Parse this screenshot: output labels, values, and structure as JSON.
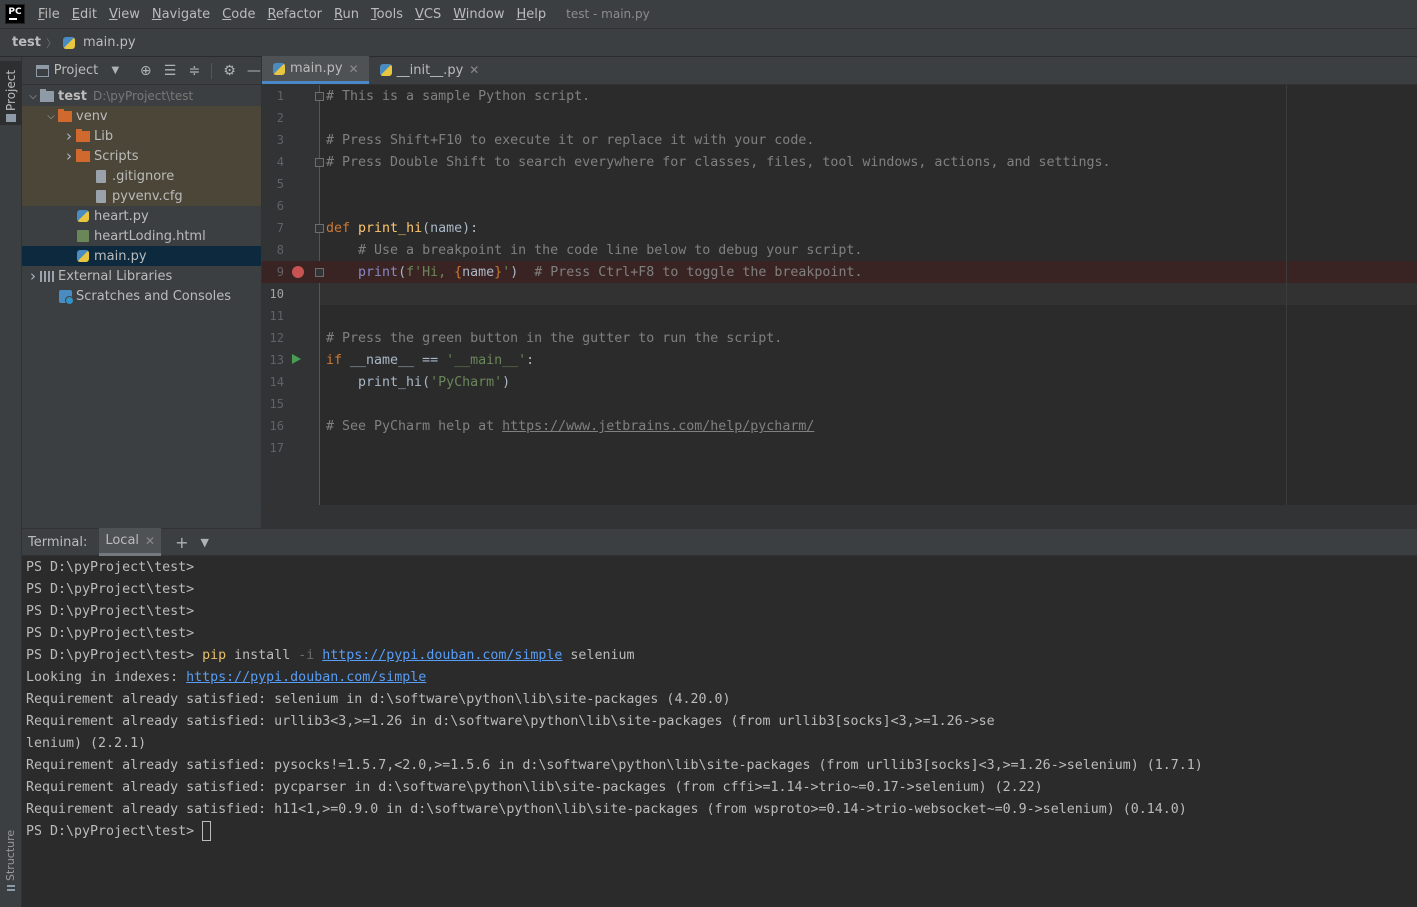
{
  "menubar": {
    "logo": "PC",
    "items": [
      {
        "u": "F",
        "rest": "ile"
      },
      {
        "u": "E",
        "rest": "dit"
      },
      {
        "u": "V",
        "rest": "iew"
      },
      {
        "u": "N",
        "rest": "avigate"
      },
      {
        "u": "C",
        "rest": "ode"
      },
      {
        "u": "R",
        "rest": "efactor"
      },
      {
        "u": "R",
        "rest": "un"
      },
      {
        "u": "T",
        "rest": "ools"
      },
      {
        "u": "V",
        "rest": "CS"
      },
      {
        "u": "W",
        "rest": "indow"
      },
      {
        "u": "H",
        "rest": "elp"
      }
    ],
    "window_title": "test - main.py"
  },
  "breadcrumb": {
    "root": "test",
    "file": "main.py"
  },
  "left_strip": {
    "project": "Project",
    "structure": "Structure"
  },
  "project_panel": {
    "title": "Project",
    "tree": [
      {
        "label": "test",
        "path": "D:\\pyProject\\test",
        "arrow": "down",
        "icon": "folder-gray",
        "indent": 0,
        "bold": true
      },
      {
        "label": "venv",
        "arrow": "down",
        "icon": "folder-orange",
        "indent": 1,
        "venv": true
      },
      {
        "label": "Lib",
        "arrow": "right",
        "icon": "folder-orange",
        "indent": 2,
        "venv": true
      },
      {
        "label": "Scripts",
        "arrow": "right",
        "icon": "folder-orange",
        "indent": 2,
        "venv": true
      },
      {
        "label": ".gitignore",
        "icon": "txt",
        "indent": 3,
        "venv": true
      },
      {
        "label": "pyvenv.cfg",
        "icon": "txt",
        "indent": 3,
        "venv": true
      },
      {
        "label": "heart.py",
        "icon": "py",
        "indent": 2
      },
      {
        "label": "heartLoding.html",
        "icon": "html",
        "indent": 2
      },
      {
        "label": "main.py",
        "icon": "py",
        "indent": 2,
        "selected": true
      },
      {
        "label": "External Libraries",
        "arrow": "right",
        "icon": "lib",
        "indent": 0
      },
      {
        "label": "Scratches and Consoles",
        "icon": "scratch",
        "indent": 1
      }
    ]
  },
  "editor_tabs": [
    {
      "label": "main.py",
      "active": true
    },
    {
      "label": "__init__.py",
      "active": false
    }
  ],
  "editor": {
    "lines": [
      [
        {
          "t": "# This is a sample Python script.",
          "c": "comment"
        }
      ],
      [],
      [
        {
          "t": "# Press Shift+F10 to execute it or replace it with your code.",
          "c": "comment"
        }
      ],
      [
        {
          "t": "# Press Double Shift to search everywhere for classes, files, tool windows, actions, and settings.",
          "c": "comment"
        }
      ],
      [],
      [],
      [
        {
          "t": "def ",
          "c": "kw"
        },
        {
          "t": "print_hi",
          "c": "fn"
        },
        {
          "t": "(name):",
          "c": "param"
        }
      ],
      [
        {
          "t": "    # Use a breakpoint in the code line below to debug your script.",
          "c": "comment"
        }
      ],
      [
        {
          "t": "    ",
          "c": "param"
        },
        {
          "t": "print",
          "c": "builtin"
        },
        {
          "t": "(",
          "c": "param"
        },
        {
          "t": "f'Hi, ",
          "c": "str"
        },
        {
          "t": "{",
          "c": "kw"
        },
        {
          "t": "name",
          "c": "param"
        },
        {
          "t": "}",
          "c": "kw"
        },
        {
          "t": "'",
          "c": "str"
        },
        {
          "t": ")  ",
          "c": "param"
        },
        {
          "t": "# Press Ctrl+F8 to toggle the breakpoint.",
          "c": "comment"
        }
      ],
      [],
      [],
      [
        {
          "t": "# Press the green button in the gutter to run the script.",
          "c": "comment"
        }
      ],
      [
        {
          "t": "if ",
          "c": "kw"
        },
        {
          "t": "__name__ == ",
          "c": "param"
        },
        {
          "t": "'__main__'",
          "c": "str"
        },
        {
          "t": ":",
          "c": "param"
        }
      ],
      [
        {
          "t": "    print_hi(",
          "c": "param"
        },
        {
          "t": "'PyCharm'",
          "c": "str"
        },
        {
          "t": ")",
          "c": "param"
        }
      ],
      [],
      [
        {
          "t": "# See PyCharm help at ",
          "c": "comment"
        },
        {
          "t": "https://www.jetbrains.com/help/pycharm/",
          "c": "link"
        }
      ],
      []
    ],
    "current_line": 10,
    "breakpoint_line": 9,
    "run_line": 13
  },
  "terminal": {
    "title": "Terminal:",
    "tab": "Local",
    "lines": [
      [
        {
          "t": "PS D:\\pyProject\\test>"
        }
      ],
      [
        {
          "t": "PS D:\\pyProject\\test>"
        }
      ],
      [
        {
          "t": "PS D:\\pyProject\\test>"
        }
      ],
      [
        {
          "t": "PS D:\\pyProject\\test>"
        }
      ],
      [
        {
          "t": "PS D:\\pyProject\\test> "
        },
        {
          "t": "pip",
          "c": "cmd"
        },
        {
          "t": " install "
        },
        {
          "t": "-i",
          "c": "dim"
        },
        {
          "t": " "
        },
        {
          "t": "https://pypi.douban.com/simple",
          "c": "link"
        },
        {
          "t": " selenium"
        }
      ],
      [
        {
          "t": "Looking in indexes: "
        },
        {
          "t": "https://pypi.douban.com/simple",
          "c": "link"
        }
      ],
      [
        {
          "t": "Requirement already satisfied: selenium in d:\\software\\python\\lib\\site-packages (4.20.0)"
        }
      ],
      [
        {
          "t": "Requirement already satisfied: urllib3<3,>=1.26 in d:\\software\\python\\lib\\site-packages (from urllib3[socks]<3,>=1.26->se"
        }
      ],
      [
        {
          "t": "lenium) (2.2.1)"
        }
      ],
      [
        {
          "t": "Requirement already satisfied: pysocks!=1.5.7,<2.0,>=1.5.6 in d:\\software\\python\\lib\\site-packages (from urllib3[socks]<3,>=1.26->selenium) (1.7.1)"
        }
      ],
      [
        {
          "t": "Requirement already satisfied: pycparser in d:\\software\\python\\lib\\site-packages (from cffi>=1.14->trio~=0.17->selenium) (2.22)"
        }
      ],
      [
        {
          "t": "Requirement already satisfied: h11<1,>=0.9.0 in d:\\software\\python\\lib\\site-packages (from wsproto>=0.14->trio-websocket~=0.9->selenium) (0.14.0)"
        }
      ],
      [
        {
          "t": "PS D:\\pyProject\\test> "
        },
        {
          "t": "",
          "c": "cursor"
        }
      ]
    ]
  },
  "colors": {
    "background": "#2b2b2b",
    "panel": "#3c3f41",
    "accent": "#4a88c7",
    "breakpoint": "#c75450",
    "run": "#499c54"
  }
}
